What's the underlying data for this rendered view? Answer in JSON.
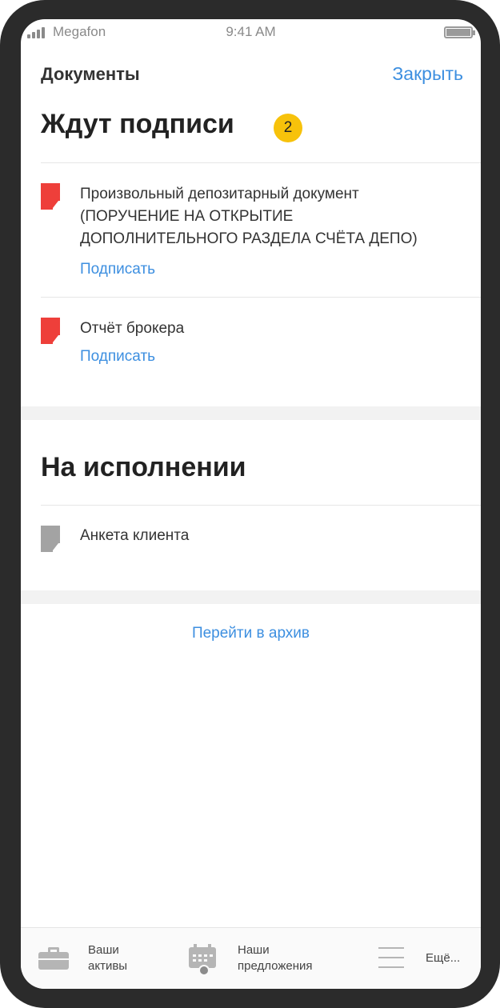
{
  "status_bar": {
    "carrier": "Megafon",
    "time": "9:41 AM"
  },
  "nav": {
    "title": "Документы",
    "close_label": "Закрыть"
  },
  "awaiting": {
    "heading": "Ждут подписи",
    "count": "2",
    "documents": [
      {
        "lines": [
          "Произвольный депозитарный документ",
          "(ПОРУЧЕНИЕ НА ОТКРЫТИЕ",
          "ДОПОЛНИТЕЛЬНОГО РАЗДЕЛА СЧЁТА ДЕПО)"
        ],
        "action": "Подписать",
        "icon": "document-red-icon"
      },
      {
        "lines": [
          "Отчёт брокера"
        ],
        "action": "Подписать",
        "icon": "document-red-icon"
      }
    ]
  },
  "in_progress": {
    "heading": "На исполнении",
    "documents": [
      {
        "lines": [
          "Анкета клиента"
        ],
        "icon": "document-gray-icon"
      }
    ]
  },
  "archive_link": "Перейти в архив",
  "tabbar": {
    "items": [
      {
        "lines": [
          "Ваши",
          "активы"
        ],
        "icon": "briefcase-icon"
      },
      {
        "lines": [
          "Наши",
          "предложения"
        ],
        "icon": "calendar-icon"
      },
      {
        "lines": [
          "Ещё..."
        ],
        "icon": "menu-icon"
      }
    ]
  },
  "colors": {
    "accent": "#3d8fe0",
    "badge": "#f7c20b",
    "doc_pending": "#ee3f3a",
    "doc_in_progress": "#a3a3a3"
  }
}
